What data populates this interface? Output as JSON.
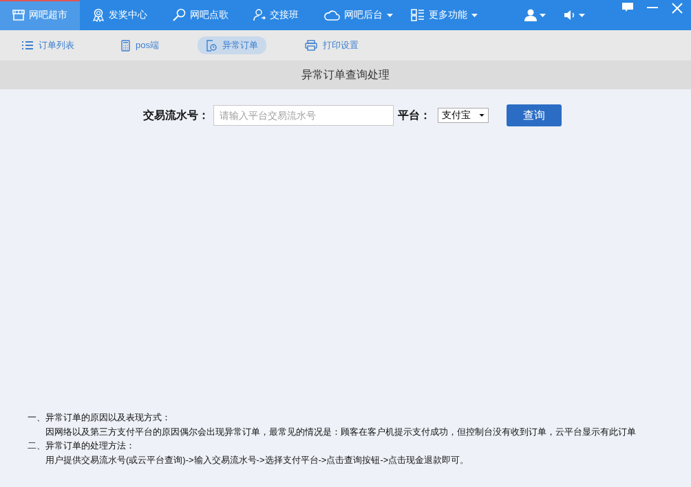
{
  "nav_items": [
    {
      "label": "网吧超市",
      "dropdown": false,
      "selected": true
    },
    {
      "label": "发奖中心",
      "dropdown": false,
      "selected": false
    },
    {
      "label": "网吧点歌",
      "dropdown": false,
      "selected": false
    },
    {
      "label": "交接班",
      "dropdown": false,
      "selected": false
    },
    {
      "label": "网吧后台",
      "dropdown": true,
      "selected": false
    },
    {
      "label": "更多功能",
      "dropdown": true,
      "selected": false
    }
  ],
  "sub_tabs": [
    {
      "label": "订单列表",
      "selected": false
    },
    {
      "label": "pos端",
      "selected": false
    },
    {
      "label": "异常订单",
      "selected": true
    },
    {
      "label": "打印设置",
      "selected": false
    }
  ],
  "page_title": "异常订单查询处理",
  "query_form": {
    "serial_label": "交易流水号：",
    "serial_placeholder": "请输入平台交易流水号",
    "platform_label": "平台：",
    "platform_value": "支付宝",
    "button": "查询"
  },
  "notes": [
    {
      "kind": "heading",
      "text": "一、异常订单的原因以及表现方式："
    },
    {
      "kind": "body",
      "text": "因网络以及第三方支付平台的原因偶尔会出现异常订单，最常见的情况是：顾客在客户机提示支付成功，但控制台没有收到订单，云平台显示有此订单"
    },
    {
      "kind": "heading",
      "text": "二、异常订单的处理方法："
    },
    {
      "kind": "body",
      "text": "用户提供交易流水号(或云平台查询)->输入交易流水号->选择支付平台->点击查询按钮->点击现金退款即可。"
    }
  ]
}
